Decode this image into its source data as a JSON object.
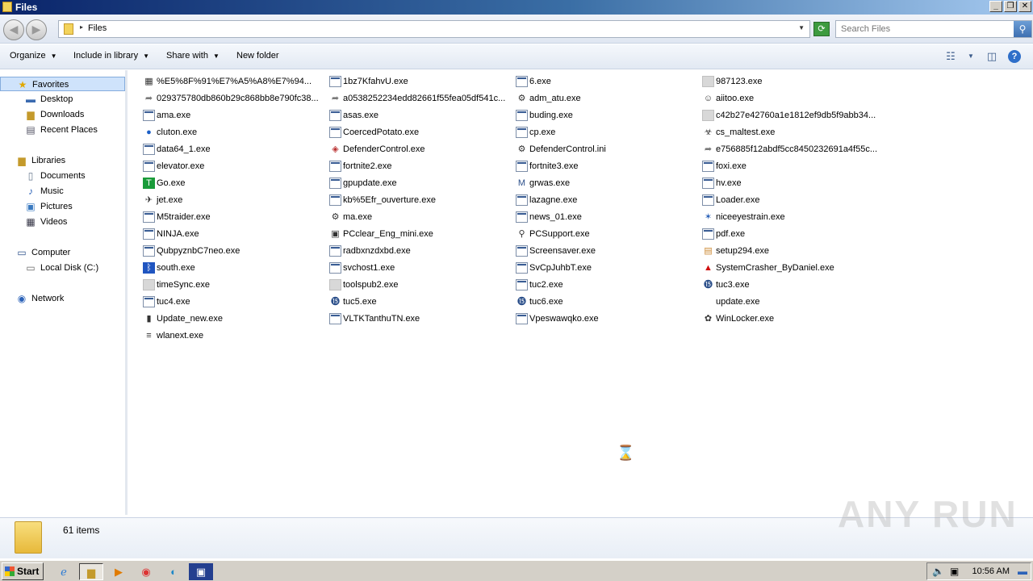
{
  "window": {
    "title": "Files"
  },
  "address": {
    "crumb": "Files",
    "search_placeholder": "Search Files"
  },
  "toolbar": {
    "organize": "Organize",
    "include_in_library": "Include in library",
    "share_with": "Share with",
    "new_folder": "New folder"
  },
  "nav": {
    "favorites": "Favorites",
    "desktop": "Desktop",
    "downloads": "Downloads",
    "recent_places": "Recent Places",
    "libraries": "Libraries",
    "documents": "Documents",
    "music": "Music",
    "pictures": "Pictures",
    "videos": "Videos",
    "computer": "Computer",
    "local_disk": "Local Disk (C:)",
    "network": "Network"
  },
  "files": [
    [
      "%E5%8F%91%E7%A5%A8%E7%94...",
      "1bz7KfahvU.exe",
      "6.exe",
      "987123.exe"
    ],
    [
      "029375780db860b29c868bb8e790fc38...",
      "a0538252234edd82661f55fea05df541c...",
      "adm_atu.exe",
      "aiitoo.exe"
    ],
    [
      "ama.exe",
      "asas.exe",
      "buding.exe",
      "c42b27e42760a1e1812ef9db5f9abb34..."
    ],
    [
      "cluton.exe",
      "CoercedPotato.exe",
      "cp.exe",
      "cs_maltest.exe"
    ],
    [
      "data64_1.exe",
      "DefenderControl.exe",
      "DefenderControl.ini",
      "e756885f12abdf5cc8450232691a4f55c..."
    ],
    [
      "elevator.exe",
      "fortnite2.exe",
      "fortnite3.exe",
      "foxi.exe"
    ],
    [
      "Go.exe",
      "gpupdate.exe",
      "grwas.exe",
      "hv.exe"
    ],
    [
      "jet.exe",
      "kb%5Efr_ouverture.exe",
      "lazagne.exe",
      "Loader.exe"
    ],
    [
      "M5traider.exe",
      "ma.exe",
      "news_01.exe",
      "niceeyestrain.exe"
    ],
    [
      "NINJA.exe",
      "PCclear_Eng_mini.exe",
      "PCSupport.exe",
      "pdf.exe"
    ],
    [
      "QubpyznbC7neo.exe",
      "radbxnzdxbd.exe",
      "Screensaver.exe",
      "setup294.exe"
    ],
    [
      "south.exe",
      "svchost1.exe",
      "SvCpJuhbT.exe",
      "SystemCrasher_ByDaniel.exe"
    ],
    [
      "timeSync.exe",
      "toolspub2.exe",
      "tuc2.exe",
      "tuc3.exe"
    ],
    [
      "tuc4.exe",
      "tuc5.exe",
      "tuc6.exe",
      "update.exe"
    ],
    [
      "Update_new.exe",
      "VLTKTanthuTN.exe",
      "Vpeswawqko.exe",
      "WinLocker.exe"
    ],
    [
      "wlanext.exe",
      "",
      "",
      ""
    ]
  ],
  "file_icons": [
    [
      "image-icon",
      "exe-icon",
      "exe-icon",
      "blank-icon"
    ],
    [
      "shortcut-icon",
      "shortcut-icon",
      "gear-exe-icon",
      "person-icon"
    ],
    [
      "exe-icon",
      "exe-icon",
      "exe-icon",
      "blank-icon"
    ],
    [
      "globe-icon",
      "exe-icon",
      "exe-icon",
      "biohazard-icon"
    ],
    [
      "exe-icon",
      "shield-icon",
      "ini-icon",
      "shortcut-icon"
    ],
    [
      "exe-icon",
      "exe-icon",
      "exe-icon",
      "exe-icon"
    ],
    [
      "green-t-icon",
      "exe-icon",
      "m-logo-icon",
      "exe-icon"
    ],
    [
      "jet-icon",
      "exe-icon",
      "exe-icon",
      "exe-icon"
    ],
    [
      "exe-icon",
      "gear-icon",
      "exe-icon",
      "star-icon"
    ],
    [
      "exe-icon",
      "pcclear-icon",
      "magnifier-icon",
      "exe-icon"
    ],
    [
      "exe-icon",
      "exe-icon",
      "exe-icon",
      "installer-icon"
    ],
    [
      "bluetooth-icon",
      "exe-icon",
      "exe-icon",
      "warning-icon"
    ],
    [
      "blank-icon",
      "blank-icon",
      "exe-icon",
      "tuc-icon"
    ],
    [
      "exe-icon",
      "tuc-icon",
      "tuc-icon",
      "none"
    ],
    [
      "book-icon",
      "exe-icon",
      "exe-icon",
      "winlocker-icon"
    ],
    [
      "wlan-icon",
      "none",
      "none",
      "none"
    ]
  ],
  "details": {
    "item_count": "61 items"
  },
  "watermark": "ANY RUN",
  "taskbar": {
    "start": "Start",
    "clock": "10:56 AM"
  }
}
